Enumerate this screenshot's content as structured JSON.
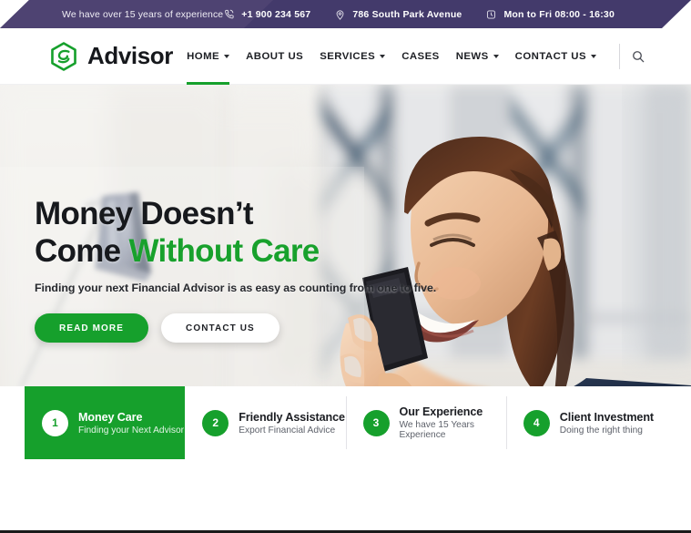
{
  "topbar": {
    "tagline": "We have over 15 years of experience",
    "items": [
      {
        "icon": "phone-icon",
        "text": "+1 900 234 567"
      },
      {
        "icon": "location-pin-icon",
        "text": "786 South Park Avenue"
      },
      {
        "icon": "clock-icon",
        "text": "Mon to Fri 08:00 - 16:30"
      }
    ]
  },
  "header": {
    "logo_text": "Advisor",
    "logo_icon": "hexagon-swirl-logo-icon",
    "search_icon": "search-icon",
    "nav": [
      {
        "label": "HOME",
        "has_caret": true,
        "active": true
      },
      {
        "label": "ABOUT US",
        "has_caret": false,
        "active": false
      },
      {
        "label": "SERVICES",
        "has_caret": true,
        "active": false
      },
      {
        "label": "CASES",
        "has_caret": false,
        "active": false
      },
      {
        "label": "NEWS",
        "has_caret": true,
        "active": false
      },
      {
        "label": "CONTACT US",
        "has_caret": true,
        "active": false
      }
    ]
  },
  "hero": {
    "heading_line1": "Money Doesn’t",
    "heading_line2_plain": "Come ",
    "heading_line2_accent": "Without Care",
    "subtitle": "Finding your next Financial Advisor is as easy as counting from one to five.",
    "primary_button": "READ MORE",
    "secondary_button": "CONTACT US"
  },
  "cards": [
    {
      "number": "1",
      "title": "Money Care",
      "subtitle": "Finding your Next Advisor",
      "active": true
    },
    {
      "number": "2",
      "title": "Friendly Assistance",
      "subtitle": "Export Financial Advice",
      "active": false
    },
    {
      "number": "3",
      "title": "Our Experience",
      "subtitle": "We have 15 Years Experience",
      "active": false
    },
    {
      "number": "4",
      "title": "Client Investment",
      "subtitle": "Doing the right thing",
      "active": false
    }
  ],
  "colors": {
    "brand_green": "#16a02c",
    "topbar_purple": "#433a6b",
    "topbar_purple_light": "#4e4372",
    "text_dark": "#17191d"
  }
}
